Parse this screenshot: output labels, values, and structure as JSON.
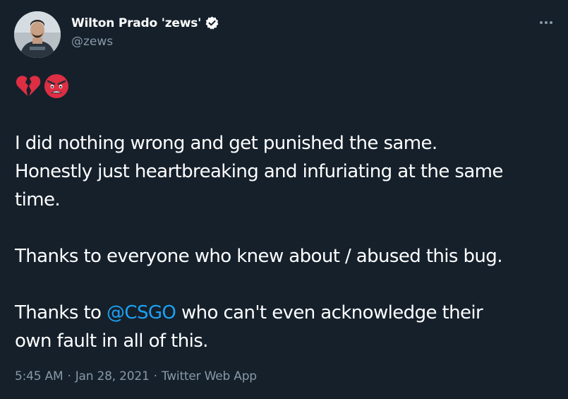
{
  "author": {
    "display_name": "Wilton Prado 'zews'",
    "handle": "@zews",
    "verified": true,
    "avatar_icon": "user-avatar"
  },
  "emojis": [
    "broken-heart-icon",
    "angry-face-icon"
  ],
  "tweet": {
    "line1": "I did nothing wrong and get punished the same.",
    "line2": "Honestly just heartbreaking and infuriating at the same",
    "line3": "time.",
    "para2": "Thanks to everyone who knew about / abused this bug.",
    "para3_prefix": "Thanks to ",
    "para3_mention": "@CSGO",
    "para3_rest_line": " who can't even acknowledge their",
    "para3_line2": "own fault in all of this."
  },
  "meta": {
    "time": "5:45 AM",
    "sep1": "·",
    "date": "Jan 28, 2021",
    "sep2": "·",
    "source": "Twitter Web App"
  },
  "colors": {
    "background": "#15202b",
    "text": "#ffffff",
    "secondary": "#8899a6",
    "link": "#1da1f2"
  }
}
